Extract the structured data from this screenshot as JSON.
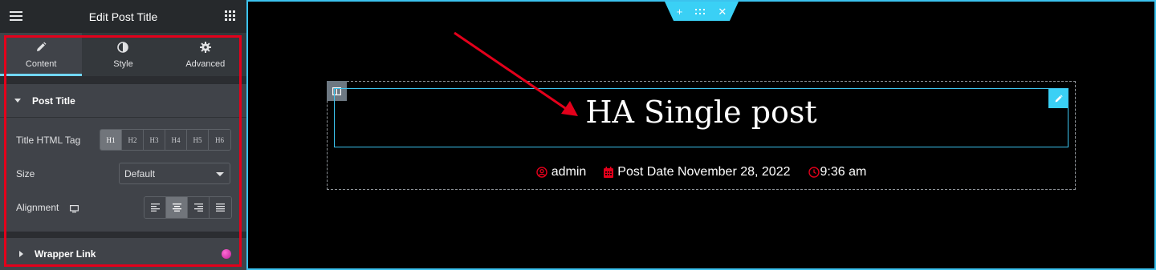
{
  "panel": {
    "title": "Edit Post Title",
    "tabs": [
      {
        "label": "Content",
        "icon": "pencil-icon"
      },
      {
        "label": "Style",
        "icon": "half-circle-icon"
      },
      {
        "label": "Advanced",
        "icon": "gear-icon"
      }
    ],
    "section_title": "Post Title",
    "title_html_tag": {
      "label": "Title HTML Tag",
      "options": [
        "H1",
        "H2",
        "H3",
        "H4",
        "H5",
        "H6"
      ],
      "selected": "H1"
    },
    "size": {
      "label": "Size",
      "value": "Default"
    },
    "alignment": {
      "label": "Alignment",
      "selected": "center"
    },
    "wrapper_link": "Wrapper Link"
  },
  "canvas": {
    "post_title": "HA Single post",
    "meta": {
      "author": "admin",
      "date": "Post Date November 28, 2022",
      "time": "9:36 am"
    }
  },
  "colors": {
    "accent": "#3ad0f5",
    "highlight": "#e3001b",
    "meta_icon": "#e3001b"
  }
}
